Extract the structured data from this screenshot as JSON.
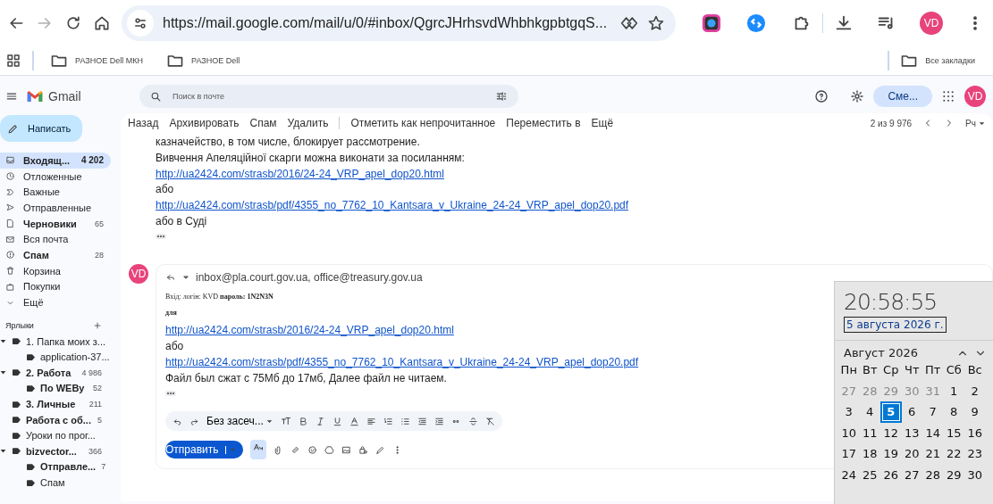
{
  "browser": {
    "forward": {
      "disabled": true
    },
    "address_bar": {
      "url": "https://mail.google.com/mail/u/0/#inbox/QgrcJHrhsvdWhbhkgpbtgqS..."
    },
    "profile": "VD"
  },
  "bookmarks": [
    {
      "label": "РАЗНОЕ Dell МКН"
    },
    {
      "label": "РАЗНОЕ Dell"
    }
  ],
  "all_bookmarks": "Все закладки",
  "gmail": {
    "app_name": "Gmail",
    "search": {
      "placeholder": "Поиск в почте"
    },
    "status_button": "Сме...",
    "avatar": "VD"
  },
  "compose": "Написать",
  "folders": [
    {
      "label": "Входящ...",
      "count": "4 202",
      "unread": true,
      "selected": true
    },
    {
      "label": "Отложенные",
      "unread": false,
      "selected": false
    },
    {
      "label": "Важные",
      "unread": false,
      "selected": false
    },
    {
      "label": "Отправленные",
      "unread": false,
      "selected": false
    },
    {
      "label": "Черновики",
      "count": "65",
      "unread": true,
      "selected": false
    },
    {
      "label": "Вся почта",
      "unread": false,
      "selected": false
    },
    {
      "label": "Спам",
      "count": "28",
      "unread": true,
      "selected": false
    },
    {
      "label": "Корзина",
      "unread": false,
      "selected": false
    },
    {
      "label": "Покупки",
      "unread": false,
      "selected": false
    },
    {
      "label": "Ещё",
      "unread": false,
      "selected": false
    }
  ],
  "labels_heading": "Ярлыки",
  "labels": [
    {
      "label": "1. Папка моих з...",
      "unread": false,
      "expanded": true,
      "children": [
        {
          "label": "application-37...",
          "unread": false
        }
      ]
    },
    {
      "label": "2. Работа",
      "count": "4 986",
      "unread": true,
      "expanded": true,
      "children": [
        {
          "label": "По WEBy",
          "count": "52",
          "unread": true
        }
      ]
    },
    {
      "label": "3. Личные",
      "count": "211",
      "unread": true
    },
    {
      "label": "Работа с об...",
      "count": "5",
      "unread": true
    },
    {
      "label": "Уроки по прог...",
      "unread": false
    },
    {
      "label": "bizvector...",
      "count": "366",
      "unread": true,
      "expanded": true,
      "children": [
        {
          "label": "Отправле...",
          "count": "7",
          "unread": true
        },
        {
          "label": "Спам",
          "unread": false
        }
      ]
    }
  ],
  "actions": [
    [
      "Назад",
      "Архивировать",
      "Спам",
      "Удалить"
    ],
    [
      "Отметить как непрочитанное",
      "Переместить в",
      "Ещё"
    ]
  ],
  "pager": {
    "text": "2 из 9 976",
    "input_tool": "Рч"
  },
  "messages": [
    {
      "lines": [
        {
          "kind": "text",
          "text": "казначейство, в том числе, блокирует рассмотрение."
        },
        {
          "kind": "text",
          "text": "Вивчення Апеляційної скарги можна виконати за посиланням:"
        },
        {
          "kind": "link",
          "text": "http://ua2424.com/strasb/2016/24-24_VRP_apel_dop20.html"
        },
        {
          "kind": "text",
          "text": "або"
        },
        {
          "kind": "link",
          "text": "http://ua2424.com/strasb/pdf/4355_no_7762_10_Kantsara_v_Ukraine_24-24_VRP_apel_dop20.pdf"
        },
        {
          "kind": "text",
          "text": "або в Суді"
        }
      ]
    },
    {
      "avatar": "VD",
      "recipients": "inbox@pla.court.gov.ua, office@treasury.gov.ua",
      "lines": [
        {
          "kind": "small",
          "text": "Вхід: логін: KVD **пароль: 1N2N3N**"
        },
        {
          "kind": "small-bold",
          "text": "для"
        },
        {
          "kind": "link",
          "text": "http://ua2424.com/strasb/2016/24-24_VRP_apel_dop20.html"
        },
        {
          "kind": "text",
          "text": "або"
        },
        {
          "kind": "link",
          "text": "http://ua2424.com/strasb/pdf/4355_no_7762_10_Kantsara_v_Ukraine_24-24_VRP_apel_dop20.pdf"
        },
        {
          "kind": "text",
          "text": "Файл был сжат с 75Мб до 17мб, Далее файл не читаем."
        }
      ],
      "composer": {
        "font": "Без засеч...",
        "send": "Отправить"
      }
    }
  ],
  "clock": {
    "time": "20:58:55",
    "date": "5 августа 2026 г.",
    "month": "Август 2026",
    "weekdays": [
      "Пн",
      "Вт",
      "Ср",
      "Чт",
      "Пт",
      "Сб",
      "Вс"
    ],
    "days": [
      {
        "day": "27",
        "outside": true,
        "selected": false
      },
      {
        "day": "28",
        "outside": true,
        "selected": false
      },
      {
        "day": "29",
        "outside": true,
        "selected": false
      },
      {
        "day": "30",
        "outside": true,
        "selected": false
      },
      {
        "day": "31",
        "outside": true,
        "selected": false
      },
      {
        "day": "1",
        "outside": false,
        "selected": false
      },
      {
        "day": "2",
        "outside": false,
        "selected": false
      },
      {
        "day": "3",
        "outside": false,
        "selected": false
      },
      {
        "day": "4",
        "outside": false,
        "selected": false
      },
      {
        "day": "5",
        "outside": false,
        "selected": true
      },
      {
        "day": "6",
        "outside": false,
        "selected": false
      },
      {
        "day": "7",
        "outside": false,
        "selected": false
      },
      {
        "day": "8",
        "outside": false,
        "selected": false
      },
      {
        "day": "9",
        "outside": false,
        "selected": false
      },
      {
        "day": "10",
        "outside": false,
        "selected": false
      },
      {
        "day": "11",
        "outside": false,
        "selected": false
      },
      {
        "day": "12",
        "outside": false,
        "selected": false
      },
      {
        "day": "13",
        "outside": false,
        "selected": false
      },
      {
        "day": "14",
        "outside": false,
        "selected": false
      },
      {
        "day": "15",
        "outside": false,
        "selected": false
      },
      {
        "day": "16",
        "outside": false,
        "selected": false
      },
      {
        "day": "17",
        "outside": false,
        "selected": false
      },
      {
        "day": "18",
        "outside": false,
        "selected": false
      },
      {
        "day": "19",
        "outside": false,
        "selected": false
      },
      {
        "day": "20",
        "outside": false,
        "selected": false
      },
      {
        "day": "21",
        "outside": false,
        "selected": false
      },
      {
        "day": "22",
        "outside": false,
        "selected": false
      },
      {
        "day": "23",
        "outside": false,
        "selected": false
      },
      {
        "day": "24",
        "outside": false,
        "selected": false
      },
      {
        "day": "25",
        "outside": false,
        "selected": false
      },
      {
        "day": "26",
        "outside": false,
        "selected": false
      },
      {
        "day": "27",
        "outside": false,
        "selected": false
      },
      {
        "day": "28",
        "outside": false,
        "selected": false
      },
      {
        "day": "29",
        "outside": false,
        "selected": false
      },
      {
        "day": "30",
        "outside": false,
        "selected": false
      }
    ]
  }
}
